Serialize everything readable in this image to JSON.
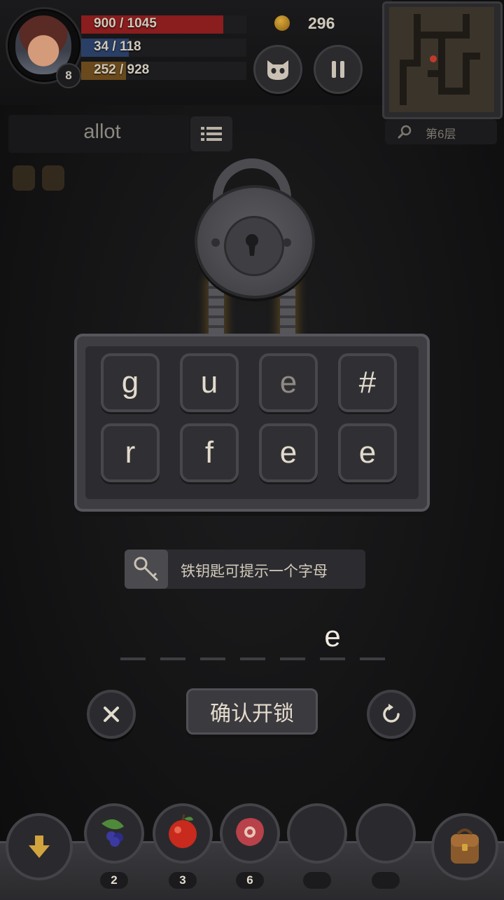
{
  "hud": {
    "level": "8",
    "hp_text": "900 / 1045",
    "hp_ratio": 0.861,
    "mp_text": "34 / 118",
    "mp_ratio": 0.288,
    "xp_text": "252 / 928",
    "xp_ratio": 0.272,
    "coins": "296",
    "floor_label": "第6层",
    "colors": {
      "hp": "#8a1d1d",
      "mp": "#2a3f66",
      "xp": "#6a4a1c",
      "coin": "#d9a93a"
    }
  },
  "word_hint": "allot",
  "letter_tiles": [
    {
      "letter": "g",
      "dim": false
    },
    {
      "letter": "u",
      "dim": false
    },
    {
      "letter": "e",
      "dim": true
    },
    {
      "letter": "#",
      "dim": false
    },
    {
      "letter": "r",
      "dim": false
    },
    {
      "letter": "f",
      "dim": false
    },
    {
      "letter": "e",
      "dim": false
    },
    {
      "letter": "e",
      "dim": false
    }
  ],
  "hint_text": "铁钥匙可提示一个字母",
  "answer": {
    "slot_count": 7,
    "filled_letter": "e",
    "filled_index": 5
  },
  "buttons": {
    "confirm_label": "确认开锁"
  },
  "inventory": [
    {
      "item": "berries",
      "count": "2"
    },
    {
      "item": "apple",
      "count": "3"
    },
    {
      "item": "meat",
      "count": "6"
    },
    {
      "item": "empty",
      "count": ""
    },
    {
      "item": "empty",
      "count": ""
    }
  ],
  "icons": {
    "pause": "pause-icon",
    "pet": "pet-icon",
    "search": "search-icon",
    "list": "list-icon",
    "key": "key-icon",
    "close": "close-icon",
    "reset": "reset-icon",
    "drop": "arrow-down-icon",
    "bag": "backpack-icon"
  }
}
